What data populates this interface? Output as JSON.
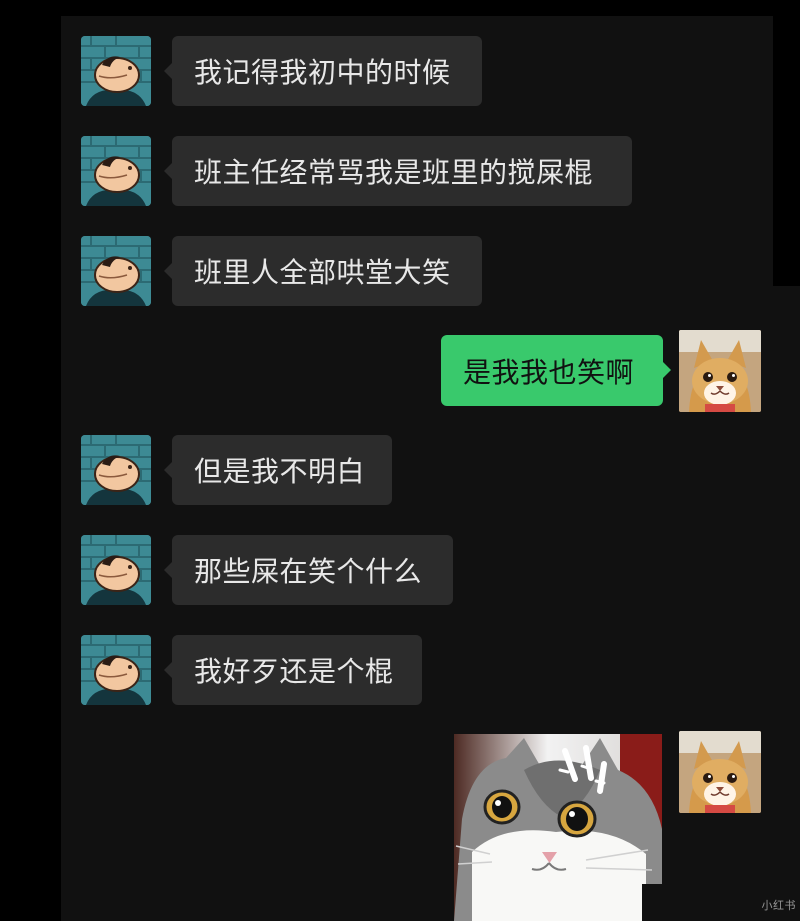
{
  "chat": {
    "messages": [
      {
        "direction": "incoming",
        "text": "我记得我初中的时候"
      },
      {
        "direction": "incoming",
        "text": "班主任经常骂我是班里的搅屎棍"
      },
      {
        "direction": "incoming",
        "text": "班里人全部哄堂大笑"
      },
      {
        "direction": "outgoing",
        "text": "是我我也笑啊"
      },
      {
        "direction": "incoming",
        "text": "但是我不明白"
      },
      {
        "direction": "incoming",
        "text": "那些屎在笑个什么"
      },
      {
        "direction": "incoming",
        "text": "我好歹还是个棍"
      },
      {
        "direction": "outgoing",
        "type": "sticker",
        "icon": "surprised-cat-sticker"
      }
    ]
  },
  "avatars": {
    "incoming_icon": "cartoon-character-avatar-icon",
    "outgoing_icon": "cat-avatar-icon"
  },
  "watermark": {
    "text": "小红书"
  },
  "colors": {
    "background": "#111111",
    "incoming_bubble": "#2c2c2c",
    "outgoing_bubble": "#39c96c"
  }
}
